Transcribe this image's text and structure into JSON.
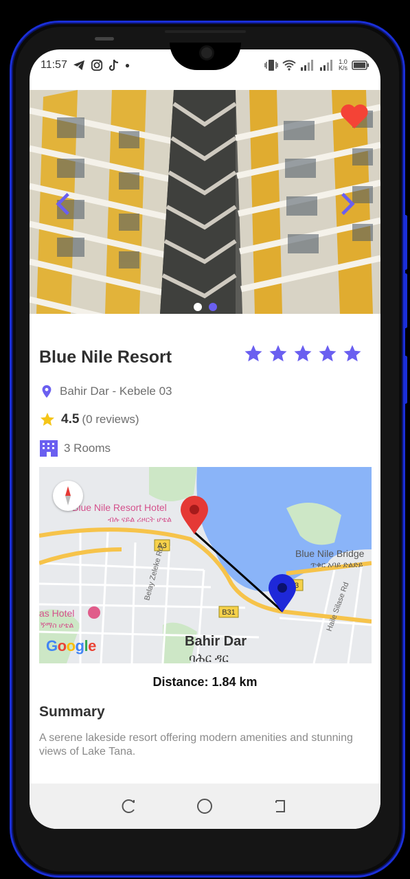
{
  "status_bar": {
    "time": "11:57",
    "network_speed": "1.0\nK/s"
  },
  "hotel": {
    "name": "Blue Nile Resort",
    "rating_stars": 5,
    "location": "Bahir Dar - Kebele 03",
    "rating": "4.5",
    "reviews": "(0 reviews)",
    "rooms": "3 Rooms"
  },
  "carousel": {
    "page_count": 2,
    "active_index": 1
  },
  "map": {
    "labels": {
      "hotel_label": "Blue Nile Resort Hotel",
      "hotel_label_amharic": "ብሉ ናይል ሪዞርት ሆቴል",
      "bridge_label": "Blue Nile Bridge",
      "bridge_label_amharic": "ጥቁር አባይ ድልድይ",
      "city_label": "Bahir Dar",
      "city_label_amharic": "ባሕር ዳር",
      "hotel2_label": "as Hotel",
      "hotel2_label_amharic": "ኝማስ ሆቴል",
      "road1": "Belay Zeleke Rd",
      "road2": "Haile Silase Rd",
      "shield_a3": "A3",
      "shield_b31": "B31",
      "shield_3": "3",
      "brand": "Google"
    }
  },
  "distance": "Distance: 1.84 km",
  "summary": {
    "title": "Summary",
    "text": "A serene lakeside resort offering modern amenities and stunning views of Lake Tana."
  },
  "colors": {
    "accent": "#6a5ff0",
    "favorite": "#f44336",
    "star_yellow": "#f5c518",
    "water": "#8ab4f8",
    "road": "#f6c34a"
  }
}
